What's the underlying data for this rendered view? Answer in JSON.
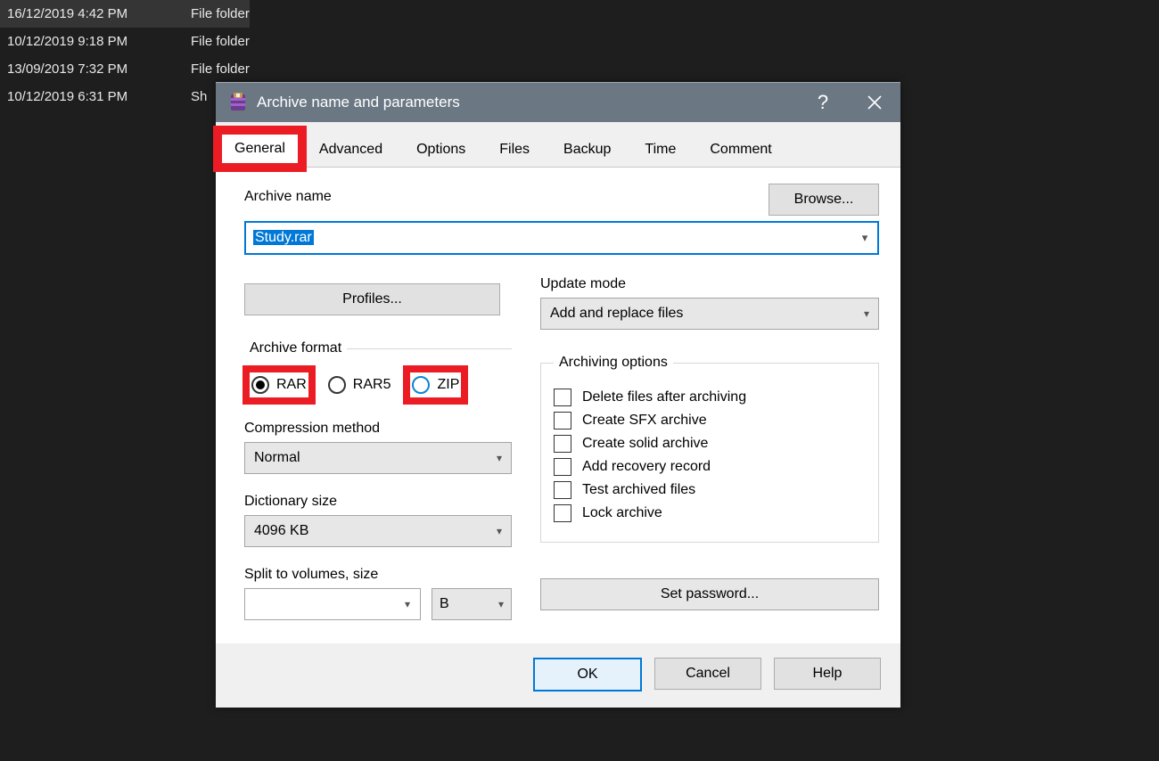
{
  "filelist": {
    "rows": [
      {
        "date": "16/12/2019 4:42 PM",
        "type": "File folder",
        "selected": true
      },
      {
        "date": "10/12/2019 9:18 PM",
        "type": "File folder",
        "selected": false
      },
      {
        "date": "13/09/2019 7:32 PM",
        "type": "File folder",
        "selected": false
      },
      {
        "date": "10/12/2019 6:31 PM",
        "type": "Sh",
        "selected": false
      }
    ]
  },
  "dialog": {
    "title": "Archive name and parameters",
    "tabs": [
      "General",
      "Advanced",
      "Options",
      "Files",
      "Backup",
      "Time",
      "Comment"
    ],
    "active_tab": "General",
    "archive_name_label": "Archive name",
    "archive_name_value": "Study.rar",
    "browse_label": "Browse...",
    "profiles_label": "Profiles...",
    "update_mode_label": "Update mode",
    "update_mode_value": "Add and replace files",
    "archive_format_label": "Archive format",
    "format": {
      "rar": "RAR",
      "rar5": "RAR5",
      "zip": "ZIP",
      "selected": "RAR"
    },
    "compression_label": "Compression method",
    "compression_value": "Normal",
    "dictionary_label": "Dictionary size",
    "dictionary_value": "4096 KB",
    "split_label": "Split to volumes, size",
    "split_value": "",
    "split_unit": "B",
    "archiving_options_label": "Archiving options",
    "options": {
      "delete": "Delete files after archiving",
      "sfx": "Create SFX archive",
      "solid": "Create solid archive",
      "recovery": "Add recovery record",
      "test": "Test archived files",
      "lock": "Lock archive"
    },
    "set_password_label": "Set password...",
    "buttons": {
      "ok": "OK",
      "cancel": "Cancel",
      "help": "Help"
    },
    "help_icon": "?",
    "close_icon": "✕"
  }
}
